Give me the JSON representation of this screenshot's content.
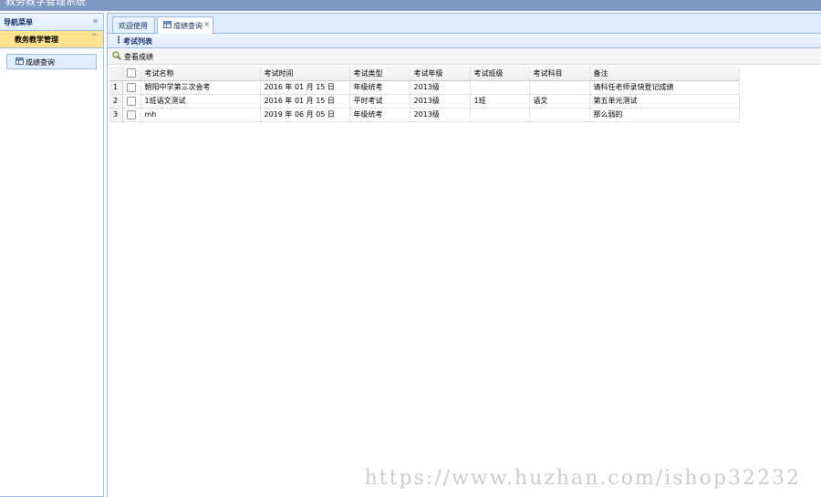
{
  "app": {
    "title": "教务教学管理系统"
  },
  "nav": {
    "header": "导航菜单",
    "collapse_icon": "«",
    "group_title": "教务教学管理",
    "group_toggle_icon": "^",
    "items": [
      {
        "label": "成绩查询"
      }
    ]
  },
  "tabs": [
    {
      "label": "欢迎使用"
    },
    {
      "label": "成绩查询",
      "close": "×"
    }
  ],
  "panel": {
    "title": "考试列表"
  },
  "toolbar": {
    "view_scores_label": "查看成绩"
  },
  "grid": {
    "columns": [
      "考试名称",
      "考试时间",
      "考试类型",
      "考试年级",
      "考试班级",
      "考试科目",
      "备注"
    ],
    "rows": [
      {
        "n": "1",
        "cells": [
          "朝阳中学第三次会考",
          "2016 年 01 月 15 日",
          "年级统考",
          "2013级",
          "",
          "",
          "请科任老师录快登记成绩"
        ]
      },
      {
        "n": "2",
        "cells": [
          "1班语文测试",
          "2016 年 01 月 15 日",
          "平时考试",
          "2013级",
          "1班",
          "语文",
          "第五单元测试"
        ]
      },
      {
        "n": "3",
        "cells": [
          "mh",
          "2019 年 06 月 05 日",
          "年级统考",
          "2013级",
          "",
          "",
          "那么弱的"
        ]
      }
    ]
  },
  "watermark": "https://www.huzhan.com/ishop32232"
}
